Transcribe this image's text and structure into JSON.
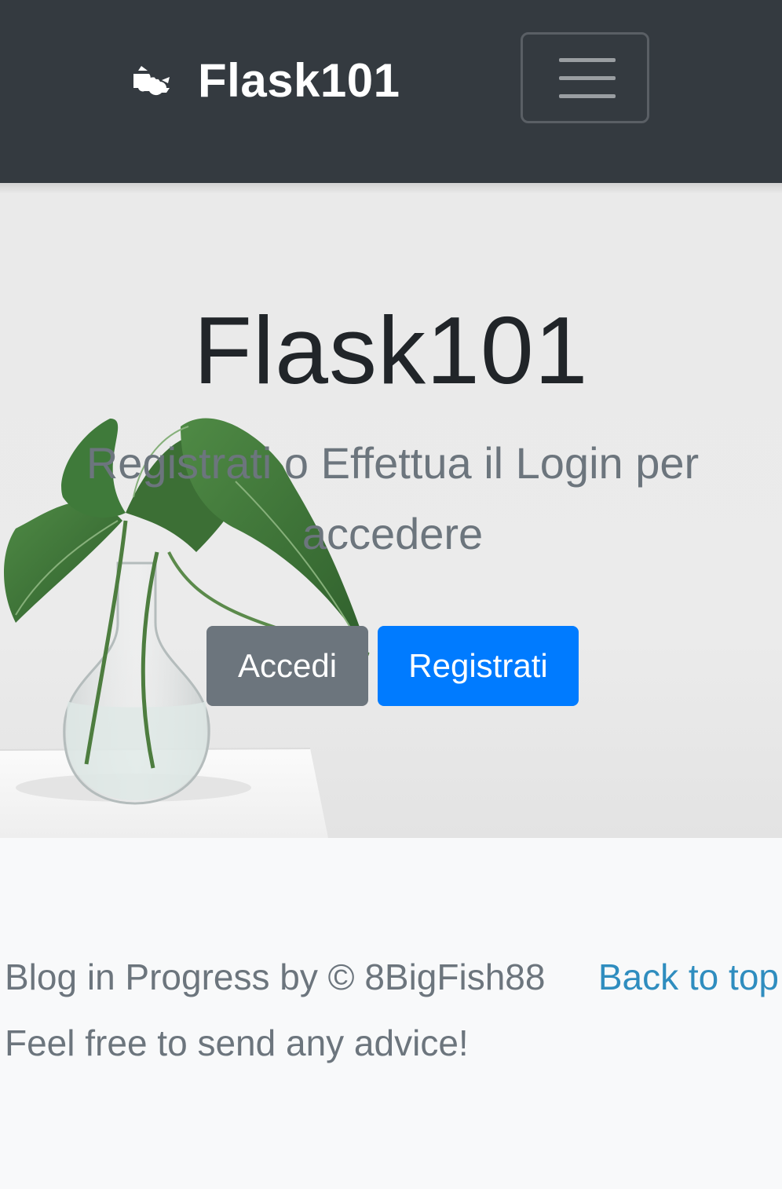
{
  "navbar": {
    "brand_name": "Flask101",
    "brand_icon": "flask-logo-icon",
    "toggler_icon": "hamburger-menu-icon",
    "background_color": "#343a40"
  },
  "hero": {
    "title": "Flask101",
    "lead": "Registrati o Effettua il Login per accedere",
    "buttons": {
      "login_label": "Accedi",
      "register_label": "Registrati"
    },
    "background_image": "plant-in-glass-vase"
  },
  "footer": {
    "credit": "Blog in Progress by © 8BigFish88",
    "back_to_top": "Back to top",
    "advice": "Feel free to send any advice!"
  },
  "colors": {
    "primary": "#007bff",
    "secondary": "#6c757d",
    "link": "#2f8dbf"
  }
}
